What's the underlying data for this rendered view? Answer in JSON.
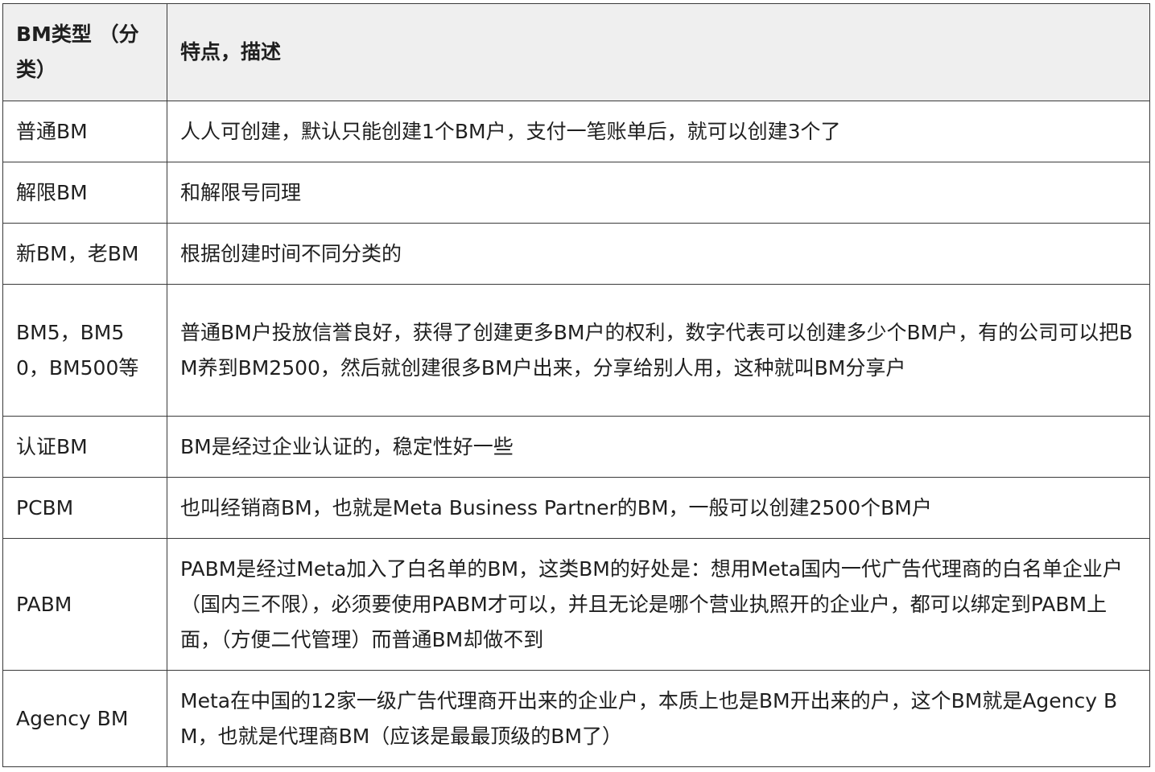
{
  "table": {
    "headers": {
      "type": "BM类型 （分类）",
      "description": "特点，描述"
    },
    "rows": [
      {
        "type": "普通BM",
        "description": "人人可创建，默认只能创建1个BM户，支付一笔账单后，就可以创建3个了"
      },
      {
        "type": "解限BM",
        "description": "和解限号同理"
      },
      {
        "type": "新BM，老BM",
        "description": "根据创建时间不同分类的"
      },
      {
        "type": "BM5，BM50，BM500等",
        "description": "普通BM户投放信誉良好，获得了创建更多BM户的权利，数字代表可以创建多少个BM户，有的公司可以把BM养到BM2500，然后就创建很多BM户出来，分享给别人用，这种就叫BM分享户"
      },
      {
        "type": "认证BM",
        "description": "BM是经过企业认证的，稳定性好一些"
      },
      {
        "type": "PCBM",
        "description": "也叫经销商BM，也就是Meta Business Partner的BM，一般可以创建2500个BM户"
      },
      {
        "type": "PABM",
        "description": "PABM是经过Meta加入了白名单的BM，这类BM的好处是：想用Meta国内一代广告代理商的白名单企业户（国内三不限），必须要使用PABM才可以，并且无论是哪个营业执照开的企业户，都可以绑定到PABM上面，（方便二代管理）而普通BM却做不到"
      },
      {
        "type": "Agency BM",
        "description": "Meta在中国的12家一级广告代理商开出来的企业户，本质上也是BM开出来的户，这个BM就是Agency BM，也就是代理商BM（应该是最最顶级的BM了）"
      }
    ]
  }
}
